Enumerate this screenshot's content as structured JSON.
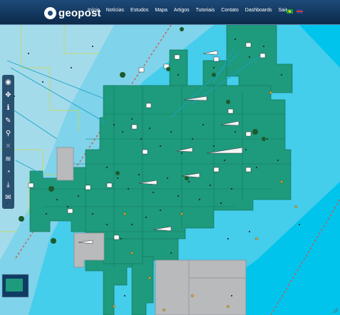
{
  "brand": {
    "name": "geopost"
  },
  "menu": {
    "items": [
      "Início",
      "Notícias",
      "Estudos",
      "Mapa",
      "Artigos",
      "Tutoriais",
      "Contato",
      "Dashboards",
      "Sair"
    ]
  },
  "languages": [
    "pt-BR",
    "en"
  ],
  "colors": {
    "navbar": "#163f69",
    "deep_water": "#00c4ec",
    "mid_water": "#5ad3ee",
    "shelf_water": "#9bd9ea",
    "block": "#1e9a7c",
    "land_block": "#b8babc",
    "wellpoint": "#1a1a1a",
    "pipeline": "#1aa3c9",
    "boundary_dash": "#e04a3a",
    "outline": "#c7d94a"
  },
  "toolbar": {
    "tools": [
      "globe-icon",
      "pan-icon",
      "info-icon",
      "draw-icon",
      "zoom-icon",
      "clear-icon",
      "layers-icon",
      "rss-icon",
      "download-icon",
      "mail-icon"
    ]
  },
  "map": {
    "features": [
      "exploration-blocks",
      "wells",
      "platforms",
      "pipelines",
      "boundary-line"
    ]
  }
}
